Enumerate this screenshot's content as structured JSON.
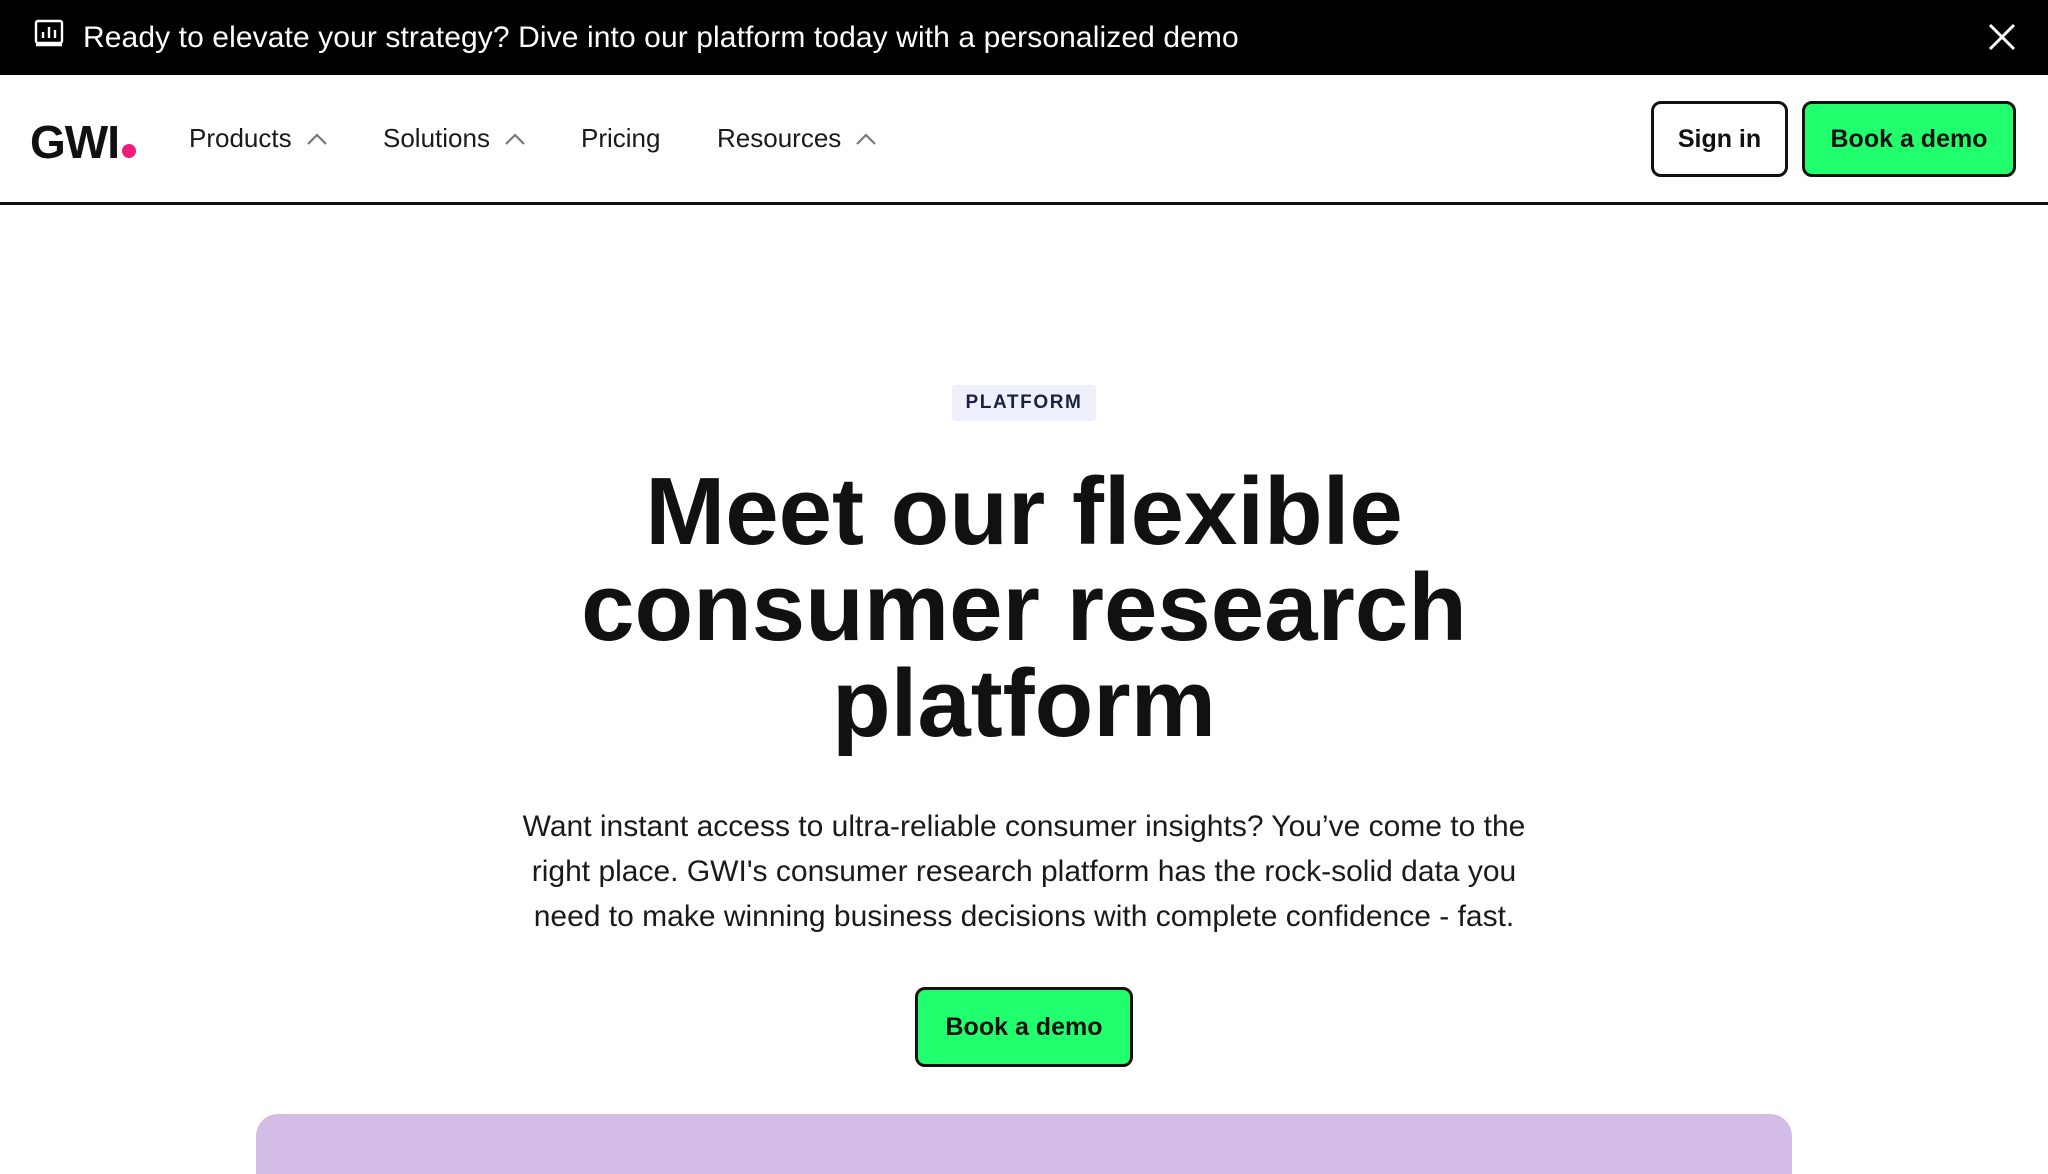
{
  "announcement": {
    "icon": "chart-screen-icon",
    "text": "Ready to elevate your strategy? Dive into our platform today with a personalized demo",
    "close_icon": "close-icon"
  },
  "nav": {
    "logo_text": "GWI",
    "logo_dot_color": "#ec1e79",
    "items": [
      {
        "label": "Products",
        "icon": "chevron-up-icon"
      },
      {
        "label": "Solutions",
        "icon": "chevron-up-icon"
      },
      {
        "label": "Pricing"
      },
      {
        "label": "Resources",
        "icon": "chevron-up-icon"
      }
    ],
    "sign_in_label": "Sign in",
    "book_demo_label": "Book a demo"
  },
  "hero": {
    "badge": "PLATFORM",
    "title_lines": [
      "Meet our flexible",
      "consumer research",
      "platform"
    ],
    "subtitle_lines": [
      "Want instant access to ultra-reliable consumer insights? You’ve come to the",
      "right place. GWI's consumer research platform has the rock-solid data you",
      "need to make winning business decisions with complete confidence - fast."
    ],
    "cta_label": "Book a demo"
  },
  "colors": {
    "accent_green": "#22ff6e",
    "brand_pink": "#ec1e79",
    "preview_purple": "#d3bde6",
    "badge_bg": "#eef1fb"
  }
}
